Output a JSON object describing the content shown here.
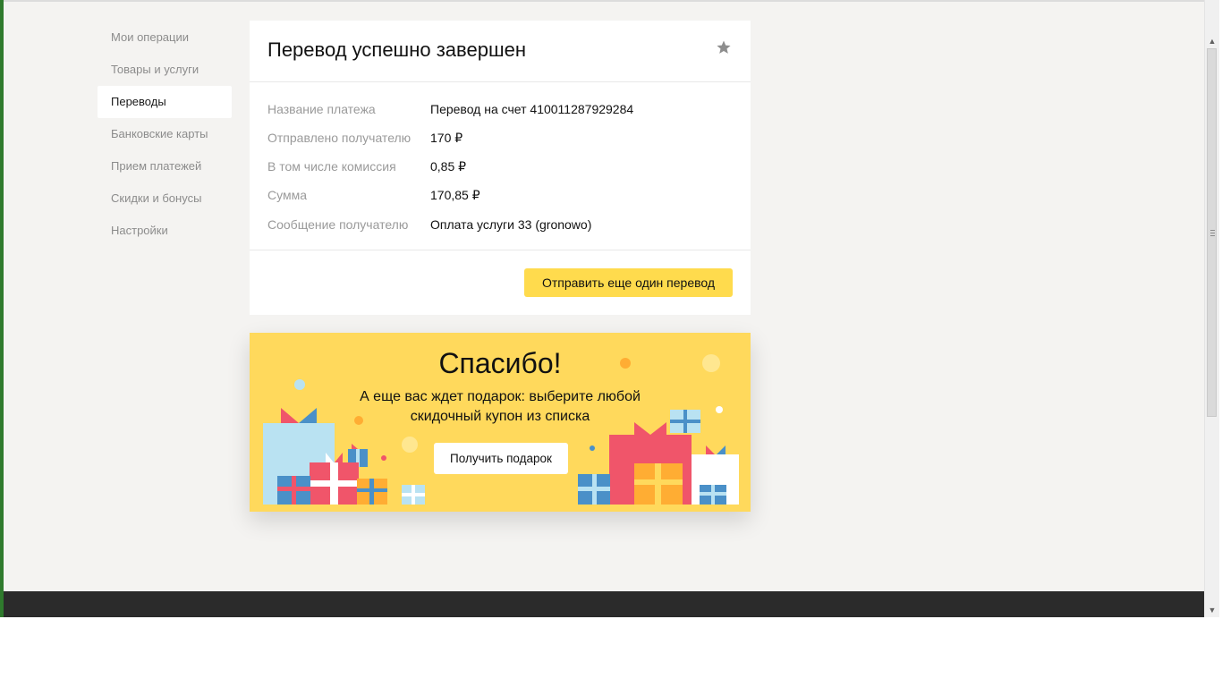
{
  "sidebar": {
    "items": [
      {
        "label": "Мои операции"
      },
      {
        "label": "Товары и услуги"
      },
      {
        "label": "Переводы"
      },
      {
        "label": "Банковские карты"
      },
      {
        "label": "Прием платежей"
      },
      {
        "label": "Скидки и бонусы"
      },
      {
        "label": "Настройки"
      }
    ],
    "active_index": 2
  },
  "result_card": {
    "title": "Перевод успешно завершен",
    "favorite_icon": "star-icon",
    "details": [
      {
        "label": "Название платежа",
        "value": "Перевод на счет 410011287929284"
      },
      {
        "label": "Отправлено получателю",
        "value": "170 ₽"
      },
      {
        "label": "В том числе комиссия",
        "value": "0,85 ₽"
      },
      {
        "label": "Сумма",
        "value": "170,85 ₽"
      },
      {
        "label": "Сообщение получателю",
        "value": "Оплата услуги 33 (gronowo)"
      }
    ],
    "send_again_button": "Отправить еще один перевод"
  },
  "promo": {
    "title": "Спасибо!",
    "subtitle_line1": "А еще вас ждет подарок: выберите любой",
    "subtitle_line2": "скидочный купон из списка",
    "button": "Получить подарок"
  },
  "colors": {
    "accent_yellow": "#ffdb4d",
    "promo_background": "#ffd95c",
    "page_background": "#f4f3f1",
    "footer": "#2b2b2b"
  }
}
